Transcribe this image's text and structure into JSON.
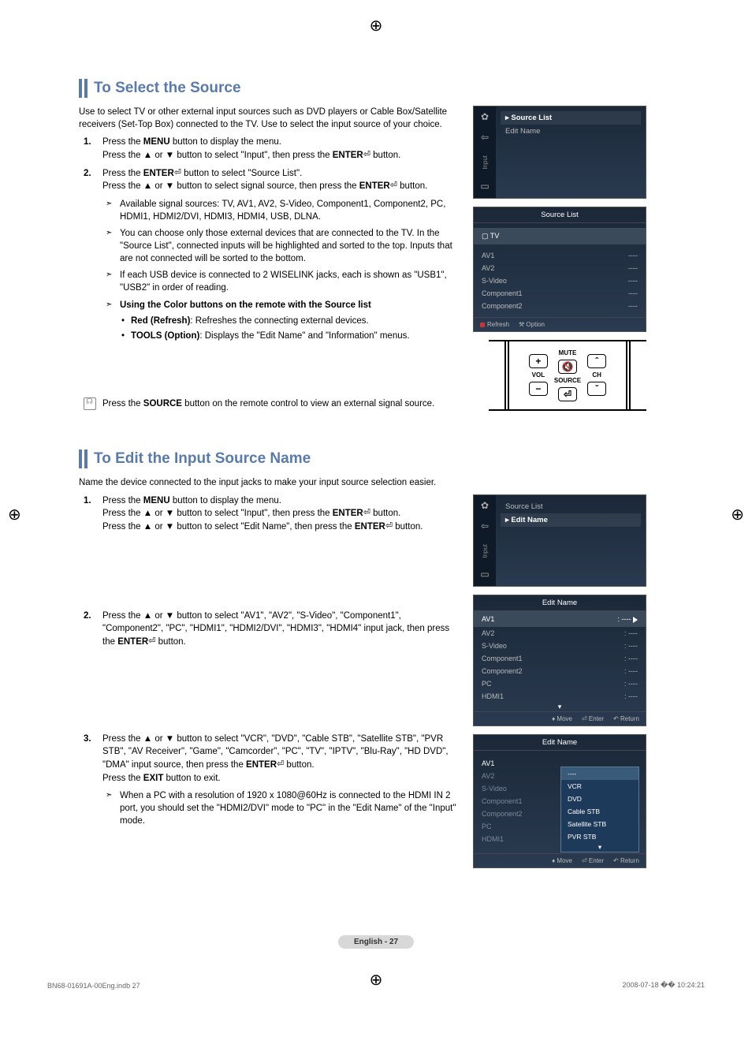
{
  "section1": {
    "title": "To Select the Source",
    "intro": "Use to select TV or other external input sources such as DVD players or Cable Box/Satellite receivers (Set-Top Box) connected to the TV. Use to select the input source of your choice.",
    "step1a": "Press the ",
    "step1a_bold": "MENU",
    "step1a_end": " button to display the menu.",
    "step1b": "Press the ▲ or ▼ button to select \"Input\", then press the ",
    "step1b_bold": "ENTER",
    "step1b_end": " button.",
    "step2a": "Press the ",
    "step2a_bold": "ENTER",
    "step2a_end": " button to select \"Source List\".",
    "step2b": "Press the ▲ or ▼ button to select signal source, then press the ",
    "step2b_bold": "ENTER",
    "step2b_end": " button.",
    "sub1": "Available signal sources: TV, AV1, AV2, S-Video, Component1, Component2, PC, HDMI1, HDMI2/DVI, HDMI3, HDMI4, USB, DLNA.",
    "sub2": "You can choose only those external devices that are connected to the TV. In the \"Source List\", connected inputs will be highlighted and sorted to the top. Inputs that are not connected will be sorted to the bottom.",
    "sub3": "If each USB device is connected to 2 WISELINK jacks, each is shown as \"USB1\", \"USB2\" in order of reading.",
    "sub4": "Using the Color buttons on the remote with the Source list",
    "mini1_bold": "Red (Refresh)",
    "mini1": ": Refreshes the connecting external devices.",
    "mini2_bold": "TOOLS (Option)",
    "mini2": ": Displays the \"Edit Name\" and \"Information\" menus.",
    "remote_note_a": "Press the ",
    "remote_note_bold": "SOURCE",
    "remote_note_b": " button on the remote control to view an external signal source."
  },
  "section2": {
    "title": "To Edit the Input Source Name",
    "intro": "Name the device connected to the input jacks to make your input source selection easier.",
    "step1a": "Press the ",
    "step1a_bold": "MENU",
    "step1a_end": " button to display the menu.",
    "step1b": "Press the ▲ or ▼ button to select \"Input\", then press the ",
    "step1b_bold": "ENTER",
    "step1b_end": " button.",
    "step1c": "Press the ▲ or ▼ button to select \"Edit Name\", then press the ",
    "step1c_bold": "ENTER",
    "step1c_end": " button.",
    "step2": "Press the ▲ or ▼ button to select \"AV1\", \"AV2\", \"S-Video\", \"Component1\", \"Component2\", \"PC\", \"HDMI1\", \"HDMI2/DVI\", \"HDMI3\", \"HDMI4\" input jack, then press the ",
    "step2_bold": "ENTER",
    "step2_end": " button.",
    "step3": "Press the ▲ or ▼ button to select \"VCR\", \"DVD\", \"Cable STB\", \"Satellite STB\", \"PVR STB\", \"AV Receiver\", \"Game\", \"Camcorder\", \"PC\", \"TV\", \"IPTV\", \"Blu-Ray\", \"HD DVD\", \"DMA\" input source, then press the ",
    "step3_bold": "ENTER",
    "step3_end": " button.",
    "step3b": "Press the ",
    "step3b_bold": "EXIT",
    "step3b_end": " button to exit.",
    "sub1": "When a PC with a resolution of 1920 x 1080@60Hz is connected to the HDMI IN 2 port, you should set the \"HDMI2/DVI\" mode to \"PC\" in the \"Edit Name\" of the \"Input\" mode."
  },
  "osd1": {
    "side_label": "Input",
    "item1": "Source List",
    "item2": "Edit Name"
  },
  "osd2": {
    "header": "Source List",
    "tv": "TV",
    "rows": [
      "AV1",
      "AV2",
      "S-Video",
      "Component1",
      "Component2"
    ],
    "dash": "----",
    "refresh": "Refresh",
    "option": "Option"
  },
  "remote": {
    "mute": "MUTE",
    "vol": "VOL",
    "source": "SOURCE",
    "ch": "CH"
  },
  "osd3": {
    "side_label": "Input",
    "item1": "Source List",
    "item2": "Edit Name"
  },
  "osd4": {
    "header": "Edit Name",
    "rows": [
      "AV1",
      "AV2",
      "S-Video",
      "Component1",
      "Component2",
      "PC",
      "HDMI1"
    ],
    "dash": ": ----",
    "move": "Move",
    "enter": "Enter",
    "return": "Return"
  },
  "osd5": {
    "header": "Edit Name",
    "left": [
      "AV1",
      "AV2",
      "S-Video",
      "Component1",
      "Component2",
      "PC",
      "HDMI1"
    ],
    "dd": [
      "----",
      "VCR",
      "DVD",
      "Cable STB",
      "Satellite STB",
      "PVR STB"
    ],
    "move": "Move",
    "enter": "Enter",
    "return": "Return"
  },
  "footer": {
    "page": "English - 27",
    "file": "BN68-01691A-00Eng.indb   27",
    "timestamp": "2008-07-18   �� 10:24:21"
  }
}
